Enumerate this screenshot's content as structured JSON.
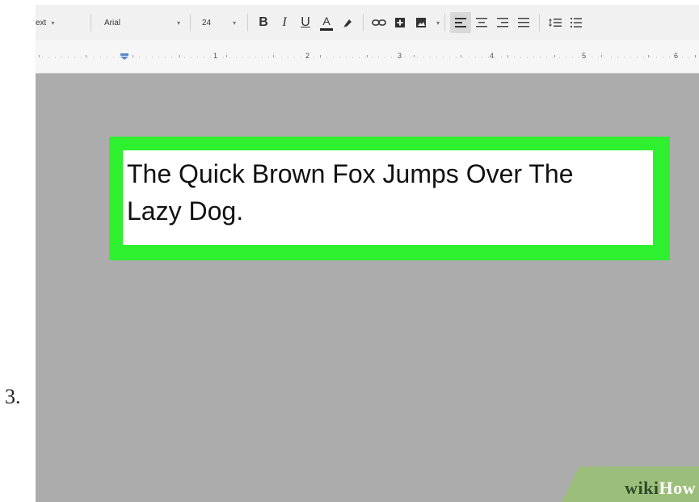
{
  "step": {
    "number": "3."
  },
  "toolbar": {
    "styles_label": "ext",
    "font_name": "Arial",
    "font_size": "24",
    "caret": "▾",
    "bold": "B",
    "italic": "I",
    "underline": "U",
    "text_color": "A"
  },
  "ruler": {
    "numbers": [
      "1",
      "2",
      "3",
      "4",
      "5",
      "6"
    ]
  },
  "document": {
    "line1": "The Quick Brown Fox Jumps Over The",
    "line2": "Lazy Dog."
  },
  "watermark": {
    "part1": "wiki",
    "part2": "How"
  },
  "colors": {
    "highlight": "#2ef02e",
    "canvas": "#acacac",
    "toolbar": "#f1f1f1"
  }
}
